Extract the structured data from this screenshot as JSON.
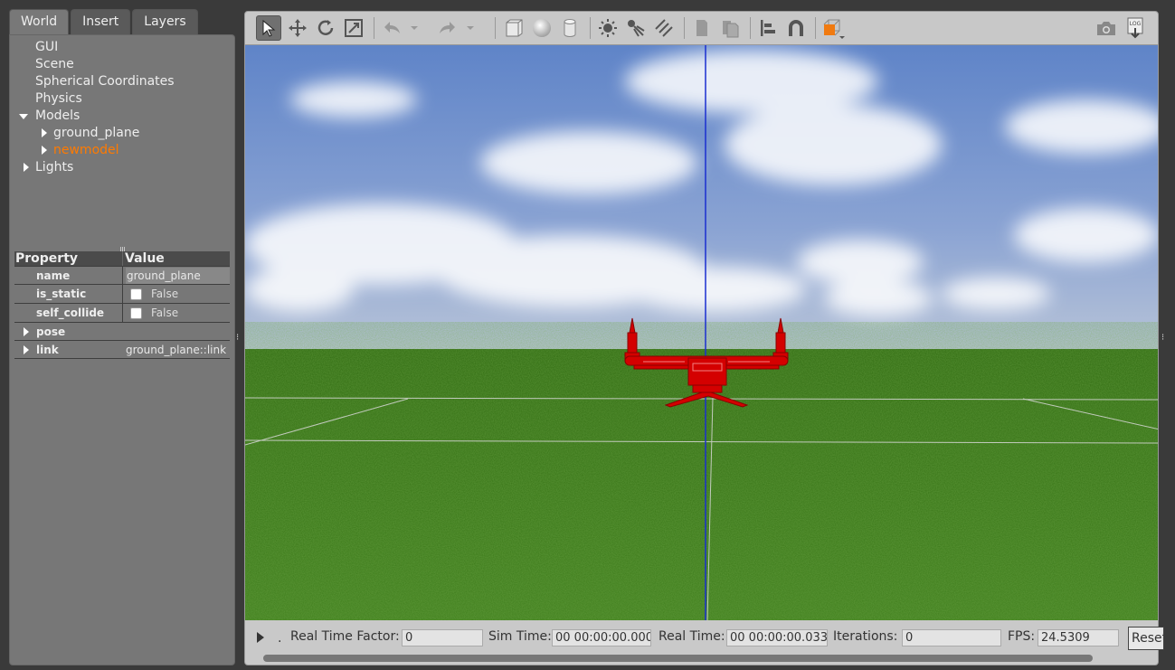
{
  "tabs": [
    {
      "label": "World"
    },
    {
      "label": "Insert"
    },
    {
      "label": "Layers"
    }
  ],
  "tree": {
    "gui": "GUI",
    "scene": "Scene",
    "spherical": "Spherical Coordinates",
    "physics": "Physics",
    "models": "Models",
    "ground_plane": "ground_plane",
    "newmodel": "newmodel",
    "lights": "Lights"
  },
  "properties": {
    "header_property": "Property",
    "header_value": "Value",
    "name_label": "name",
    "name_value": "ground_plane",
    "is_static_label": "is_static",
    "is_static_value": "False",
    "self_collide_label": "self_collide",
    "self_collide_value": "False",
    "pose_label": "pose",
    "link_label": "link",
    "link_value": "ground_plane::link"
  },
  "toolbar_icons": [
    "select-icon",
    "translate-icon",
    "rotate-icon",
    "scale-icon",
    "undo-icon",
    "undo-dropdown-icon",
    "redo-icon",
    "redo-dropdown-icon",
    "box-icon",
    "sphere-icon",
    "cylinder-icon",
    "point-light-icon",
    "spot-light-icon",
    "directional-light-icon",
    "copy-icon",
    "paste-icon",
    "align-icon",
    "magnet-icon",
    "view-angle-icon",
    "screenshot-icon",
    "log-icon"
  ],
  "status": {
    "rtf_label": "Real Time Factor:",
    "rtf_value": "0",
    "sim_label": "Sim Time:",
    "sim_value": "00 00:00:00.000",
    "real_label": "Real Time:",
    "real_value": "00 00:00:00.033",
    "iter_label": "Iterations:",
    "iter_value": "0",
    "fps_label": "FPS:",
    "fps_value": "24.5309",
    "reset_label": "Reset",
    "dot": "."
  },
  "colors": {
    "accent_selected": "#ff7a00",
    "model_red": "#cc0000",
    "sky": "#6a8fd0",
    "grass": "#3e7a1a"
  }
}
